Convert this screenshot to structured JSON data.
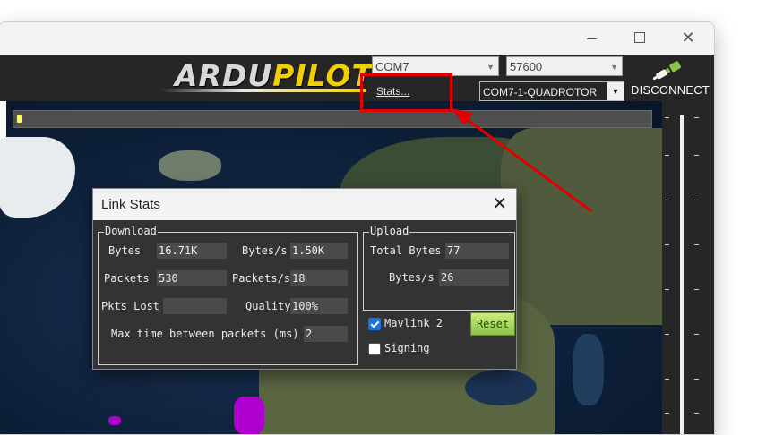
{
  "window": {
    "controls": {
      "minimize": "",
      "maximize": "",
      "close": "✕"
    }
  },
  "toolbar": {
    "logo_part1": "ARDU",
    "logo_part2": "PILOT",
    "port": "COM7",
    "baud": "57600",
    "vehicle": "COM7-1-QUADROTOR",
    "stats_link": "Stats...",
    "disconnect_label": "DISCONNECT"
  },
  "dialog": {
    "title": "Link Stats",
    "close": "✕",
    "download": {
      "group_label": "Download",
      "bytes_label": "Bytes",
      "bytes_value": "16.71K",
      "bytes_per_s_label": "Bytes/s",
      "bytes_per_s_value": "1.50K",
      "packets_label": "Packets",
      "packets_value": "530",
      "packets_per_s_label": "Packets/s",
      "packets_per_s_value": "18",
      "pkts_lost_label": "Pkts Lost",
      "pkts_lost_value": "",
      "quality_label": "Quality",
      "quality_value": "100%",
      "max_time_label": "Max time between packets (ms)",
      "max_time_value": "2"
    },
    "upload": {
      "group_label": "Upload",
      "total_bytes_label": "Total Bytes",
      "total_bytes_value": "77",
      "bytes_per_s_label": "Bytes/s",
      "bytes_per_s_value": "26"
    },
    "mavlink2": {
      "label": "Mavlink 2",
      "checked": true
    },
    "signing": {
      "label": "Signing",
      "checked": false
    },
    "reset_label": "Reset"
  },
  "colors": {
    "toolbar_bg": "#262626",
    "dialog_bg": "#333333",
    "logo_yellow": "#f0d000",
    "annotation_red": "#e00000",
    "reset_green": "#9acd32"
  }
}
